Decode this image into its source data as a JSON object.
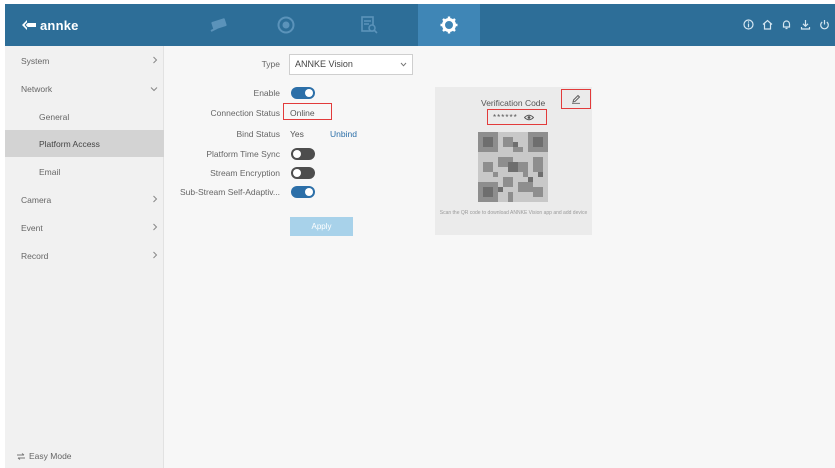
{
  "brand": {
    "name": "annke"
  },
  "colors": {
    "topbar": "#2d6e98",
    "active_tab": "#3f86b6",
    "accent": "#2c6fa8",
    "highlight": "#e23b3b"
  },
  "topnav": {
    "tabs": [
      {
        "icon": "camera-icon",
        "active": false
      },
      {
        "icon": "playback-icon",
        "active": false
      },
      {
        "icon": "file-search-icon",
        "active": false
      },
      {
        "icon": "settings-gear-icon",
        "active": true
      }
    ],
    "right_icons": [
      "info-icon",
      "home-icon",
      "bell-icon",
      "download-icon",
      "power-icon"
    ]
  },
  "sidebar": {
    "items": [
      {
        "label": "System",
        "level": "top",
        "chevron": "right"
      },
      {
        "label": "Network",
        "level": "top",
        "chevron": "down"
      },
      {
        "label": "General",
        "level": "sub"
      },
      {
        "label": "Platform Access",
        "level": "sub",
        "active": true
      },
      {
        "label": "Email",
        "level": "sub"
      },
      {
        "label": "Camera",
        "level": "top",
        "chevron": "right"
      },
      {
        "label": "Event",
        "level": "top",
        "chevron": "right"
      },
      {
        "label": "Record",
        "level": "top",
        "chevron": "right"
      }
    ],
    "easy_mode": "Easy Mode"
  },
  "form": {
    "type_label": "Type",
    "type_value": "ANNKE Vision",
    "enable_label": "Enable",
    "enable": true,
    "connection_status_label": "Connection Status",
    "connection_status_value": "Online",
    "bind_status_label": "Bind Status",
    "bind_status_value": "Yes",
    "unbind_label": "Unbind",
    "platform_time_sync_label": "Platform Time Sync",
    "platform_time_sync": false,
    "stream_encryption_label": "Stream Encryption",
    "stream_encryption": false,
    "sub_stream_label": "Sub-Stream Self-Adaptiv...",
    "sub_stream": true,
    "apply_label": "Apply"
  },
  "verification": {
    "title": "Verification Code",
    "masked_code": "******",
    "caption": "Scan the QR code to download ANNKE Vision app and add device"
  }
}
